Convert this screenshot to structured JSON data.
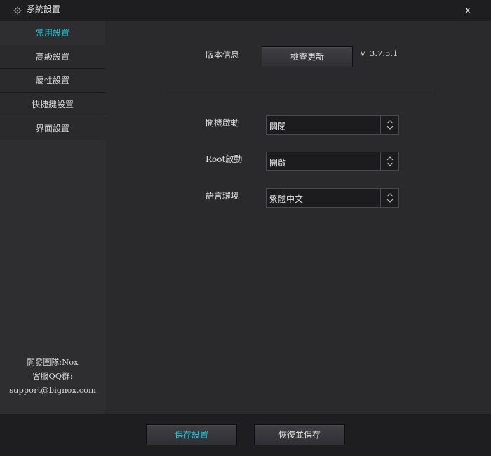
{
  "window": {
    "title": "系統設置",
    "close_label": "x"
  },
  "sidebar": {
    "items": [
      {
        "label": "常用設置",
        "active": true
      },
      {
        "label": "高級設置"
      },
      {
        "label": "屬性設置"
      },
      {
        "label": "快捷鍵設置"
      },
      {
        "label": "界面設置"
      }
    ],
    "info": {
      "team": "開發團隊:Nox",
      "qq": "客服QQ群:",
      "email": "support@bignox.com"
    }
  },
  "content": {
    "version": {
      "label": "版本信息",
      "check_button": "檢查更新",
      "value": "V_3.7.5.1"
    },
    "settings": [
      {
        "label": "開機啟動",
        "value": "關閉"
      },
      {
        "label": "Root啟動",
        "value": "開啟"
      },
      {
        "label": "語言環境",
        "value": "繁體中文"
      }
    ]
  },
  "footer": {
    "save_label": "保存設置",
    "restore_label": "恢復並保存"
  },
  "colors": {
    "accent": "#26c6da",
    "background": "#2a2a2d",
    "titlebar": "#1e1e20"
  }
}
